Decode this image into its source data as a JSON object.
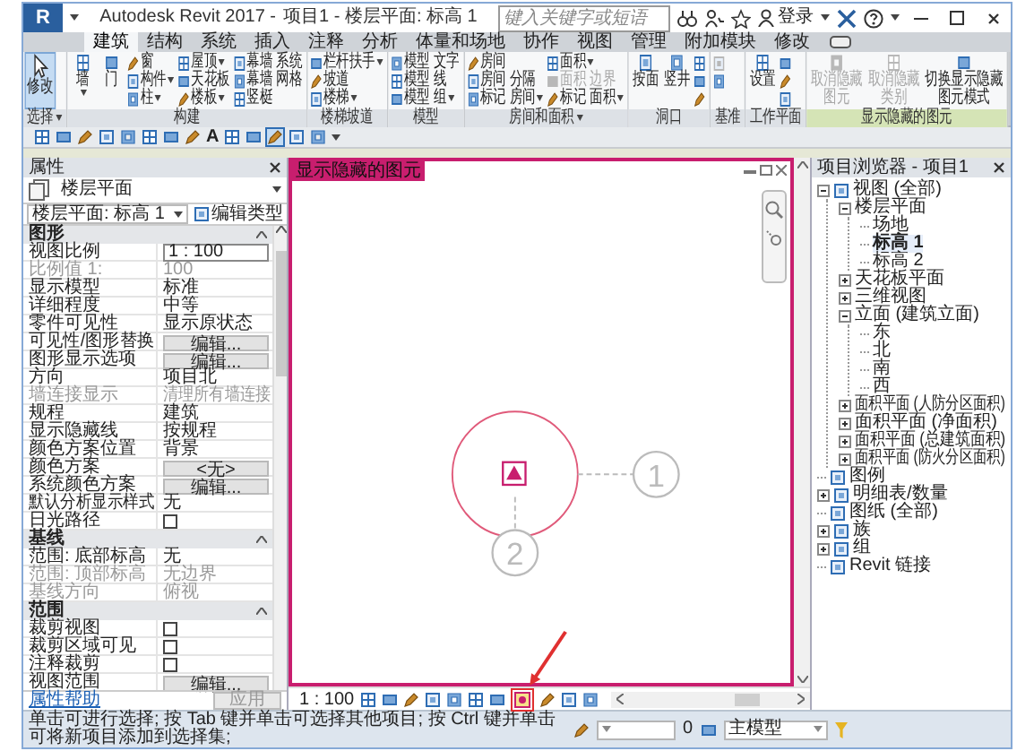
{
  "window": {
    "logo": "R",
    "title": "Autodesk Revit 2017 -",
    "document": "项目1 - 楼层平面: 标高 1"
  },
  "search": {
    "placeholder": "键入关键字或短语"
  },
  "account": {
    "label": "登录"
  },
  "tabs": [
    {
      "label": "建筑",
      "selected": true
    },
    {
      "label": "结构",
      "selected": false
    },
    {
      "label": "系统",
      "selected": false
    },
    {
      "label": "插入",
      "selected": false
    },
    {
      "label": "注释",
      "selected": false
    },
    {
      "label": "分析",
      "selected": false
    },
    {
      "label": "体量和场地",
      "selected": false
    },
    {
      "label": "协作",
      "selected": false
    },
    {
      "label": "视图",
      "selected": false
    },
    {
      "label": "管理",
      "selected": false
    },
    {
      "label": "附加模块",
      "selected": false
    },
    {
      "label": "修改",
      "selected": false
    }
  ],
  "ribbon": {
    "panels": [
      {
        "label": "选择",
        "menu": true,
        "highlighted": false,
        "buttons": [
          {
            "kind": "large",
            "label": "修改",
            "dropdown": false,
            "disabled": false,
            "pressed": true
          }
        ]
      },
      {
        "label": "构建",
        "menu": false,
        "highlighted": false,
        "buttons": [
          {
            "kind": "large",
            "label": "墙",
            "dropdown": true,
            "disabled": false,
            "pressed": false
          },
          {
            "kind": "large",
            "label": "门",
            "dropdown": false,
            "disabled": false,
            "pressed": false
          },
          {
            "kind": "small",
            "label": "窗",
            "dropdown": false,
            "disabled": false,
            "pressed": false
          },
          {
            "kind": "small",
            "label": "构件",
            "dropdown": true,
            "disabled": false,
            "pressed": false
          },
          {
            "kind": "small",
            "label": "柱",
            "dropdown": true,
            "disabled": false,
            "pressed": false
          },
          {
            "kind": "small",
            "label": "屋顶",
            "dropdown": true,
            "disabled": false,
            "pressed": false
          },
          {
            "kind": "small",
            "label": "天花板",
            "dropdown": false,
            "disabled": false,
            "pressed": false
          },
          {
            "kind": "small",
            "label": "楼板",
            "dropdown": true,
            "disabled": false,
            "pressed": false
          },
          {
            "kind": "small",
            "label": "幕墙 系统",
            "dropdown": false,
            "disabled": false,
            "pressed": false
          },
          {
            "kind": "small",
            "label": "幕墙 网格",
            "dropdown": false,
            "disabled": false,
            "pressed": false
          },
          {
            "kind": "small",
            "label": "竖梃",
            "dropdown": false,
            "disabled": false,
            "pressed": false
          }
        ]
      },
      {
        "label": "楼梯坡道",
        "menu": false,
        "highlighted": false,
        "buttons": [
          {
            "kind": "small",
            "label": "栏杆扶手",
            "dropdown": true,
            "disabled": false,
            "pressed": false
          },
          {
            "kind": "small",
            "label": "坡道",
            "dropdown": false,
            "disabled": false,
            "pressed": false
          },
          {
            "kind": "small",
            "label": "楼梯",
            "dropdown": true,
            "disabled": false,
            "pressed": false
          }
        ]
      },
      {
        "label": "模型",
        "menu": false,
        "highlighted": false,
        "buttons": [
          {
            "kind": "small",
            "label": "模型 文字",
            "dropdown": false,
            "disabled": false,
            "pressed": false
          },
          {
            "kind": "small",
            "label": "模型 线",
            "dropdown": false,
            "disabled": false,
            "pressed": false
          },
          {
            "kind": "small",
            "label": "模型 组",
            "dropdown": true,
            "disabled": false,
            "pressed": false
          }
        ]
      },
      {
        "label": "房间和面积",
        "menu": true,
        "highlighted": false,
        "buttons": [
          {
            "kind": "small",
            "label": "房间",
            "dropdown": false,
            "disabled": false,
            "pressed": false
          },
          {
            "kind": "small",
            "label": "房间 分隔",
            "dropdown": false,
            "disabled": false,
            "pressed": false
          },
          {
            "kind": "small",
            "label": "标记 房间",
            "dropdown": true,
            "disabled": false,
            "pressed": false
          },
          {
            "kind": "small",
            "label": "面积",
            "dropdown": true,
            "disabled": false,
            "pressed": false
          },
          {
            "kind": "small",
            "label": "面积 边界",
            "dropdown": false,
            "disabled": true,
            "pressed": false
          },
          {
            "kind": "small",
            "label": "标记 面积",
            "dropdown": true,
            "disabled": false,
            "pressed": false
          }
        ]
      },
      {
        "label": "洞口",
        "menu": false,
        "highlighted": false,
        "buttons": [
          {
            "kind": "large",
            "label": "按面",
            "dropdown": false,
            "disabled": false,
            "pressed": false
          },
          {
            "kind": "large",
            "label": "竖井",
            "dropdown": false,
            "disabled": false,
            "pressed": false
          },
          {
            "kind": "icon",
            "dropdown": false,
            "disabled": false,
            "pressed": false
          },
          {
            "kind": "icon",
            "dropdown": false,
            "disabled": false,
            "pressed": false
          },
          {
            "kind": "icon",
            "dropdown": false,
            "disabled": false,
            "pressed": false
          }
        ]
      },
      {
        "label": "基准",
        "menu": false,
        "highlighted": false,
        "buttons": [
          {
            "kind": "icon",
            "dropdown": false,
            "disabled": true,
            "pressed": false
          },
          {
            "kind": "icon",
            "dropdown": false,
            "disabled": false,
            "pressed": false
          }
        ]
      },
      {
        "label": "工作平面",
        "menu": false,
        "highlighted": false,
        "buttons": [
          {
            "kind": "large",
            "label": "设置",
            "dropdown": false,
            "disabled": false,
            "pressed": false
          },
          {
            "kind": "icon",
            "dropdown": false,
            "disabled": false,
            "pressed": false
          },
          {
            "kind": "icon",
            "dropdown": false,
            "disabled": false,
            "pressed": false
          },
          {
            "kind": "icon",
            "dropdown": false,
            "disabled": false,
            "pressed": false
          }
        ]
      },
      {
        "label": "显示隐藏的图元",
        "menu": false,
        "highlighted": true,
        "buttons": [
          {
            "kind": "large",
            "label": "取消隐藏图元",
            "dropdown": false,
            "disabled": true,
            "pressed": false
          },
          {
            "kind": "large",
            "label": "取消隐藏类别",
            "dropdown": false,
            "disabled": true,
            "pressed": false
          },
          {
            "kind": "large",
            "label": "切换显示隐藏图元模式",
            "dropdown": false,
            "disabled": false,
            "pressed": false
          }
        ]
      }
    ]
  },
  "quick_access": {
    "text_tool": "A"
  },
  "properties": {
    "title": "属性",
    "type_name": "楼层平面",
    "instance": "楼层平面: 标高 1",
    "edit_type": "编辑类型",
    "groups": [
      {
        "name": "图形",
        "rows": [
          {
            "label": "视图比例",
            "value": "1 : 100",
            "kind": "input",
            "disabled": false
          },
          {
            "label": "比例值 1:",
            "value": "100",
            "kind": "text",
            "disabled": true
          },
          {
            "label": "显示模型",
            "value": "标准",
            "kind": "text",
            "disabled": false
          },
          {
            "label": "详细程度",
            "value": "中等",
            "kind": "text",
            "disabled": false
          },
          {
            "label": "零件可见性",
            "value": "显示原状态",
            "kind": "text",
            "disabled": false
          },
          {
            "label": "可见性/图形替换",
            "value": "编辑...",
            "kind": "button",
            "disabled": false
          },
          {
            "label": "图形显示选项",
            "value": "编辑...",
            "kind": "button",
            "disabled": false
          },
          {
            "label": "方向",
            "value": "项目北",
            "kind": "text",
            "disabled": false
          },
          {
            "label": "墙连接显示",
            "value": "清理所有墙连接",
            "kind": "text",
            "disabled": true
          },
          {
            "label": "规程",
            "value": "建筑",
            "kind": "text",
            "disabled": false
          },
          {
            "label": "显示隐藏线",
            "value": "按规程",
            "kind": "text",
            "disabled": false
          },
          {
            "label": "颜色方案位置",
            "value": "背景",
            "kind": "text",
            "disabled": false
          },
          {
            "label": "颜色方案",
            "value": "<无>",
            "kind": "button",
            "disabled": false
          },
          {
            "label": "系统颜色方案",
            "value": "编辑...",
            "kind": "button",
            "disabled": false
          },
          {
            "label": "默认分析显示样式",
            "value": "无",
            "kind": "text",
            "disabled": false
          },
          {
            "label": "日光路径",
            "kind": "checkbox",
            "checked": false,
            "disabled": false
          }
        ]
      },
      {
        "name": "基线",
        "rows": [
          {
            "label": "范围: 底部标高",
            "value": "无",
            "kind": "text",
            "disabled": false
          },
          {
            "label": "范围: 顶部标高",
            "value": "无边界",
            "kind": "text",
            "disabled": true
          },
          {
            "label": "基线方向",
            "value": "俯视",
            "kind": "text",
            "disabled": true
          }
        ]
      },
      {
        "name": "范围",
        "rows": [
          {
            "label": "裁剪视图",
            "kind": "checkbox",
            "checked": false,
            "disabled": false
          },
          {
            "label": "裁剪区域可见",
            "kind": "checkbox",
            "checked": false,
            "disabled": false
          },
          {
            "label": "注释裁剪",
            "kind": "checkbox",
            "checked": false,
            "disabled": false
          },
          {
            "label": "视图范围",
            "value": "编辑...",
            "kind": "button",
            "disabled": false
          }
        ]
      }
    ],
    "help": "属性帮助",
    "apply": "应用"
  },
  "view": {
    "title": "显示隐藏的图元",
    "scale": "1 : 100",
    "bubbles": [
      "1",
      "2"
    ]
  },
  "project_browser": {
    "title": "项目浏览器 - 项目1",
    "tree": [
      {
        "label": "视图 (全部)",
        "expanded": true,
        "selected": false,
        "children": [
          {
            "label": "楼层平面",
            "expanded": true,
            "selected": false,
            "children": [
              {
                "label": "场地",
                "selected": false
              },
              {
                "label": "标高 1",
                "selected": true
              },
              {
                "label": "标高 2",
                "selected": false
              }
            ]
          },
          {
            "label": "天花板平面",
            "expanded": false,
            "selected": false
          },
          {
            "label": "三维视图",
            "expanded": false,
            "selected": false
          },
          {
            "label": "立面 (建筑立面)",
            "expanded": true,
            "selected": false,
            "children": [
              {
                "label": "东",
                "selected": false
              },
              {
                "label": "北",
                "selected": false
              },
              {
                "label": "南",
                "selected": false
              },
              {
                "label": "西",
                "selected": false
              }
            ]
          },
          {
            "label": "面积平面 (人防分区面积)",
            "expanded": false,
            "selected": false
          },
          {
            "label": "面积平面 (净面积)",
            "expanded": false,
            "selected": false
          },
          {
            "label": "面积平面 (总建筑面积)",
            "expanded": false,
            "selected": false
          },
          {
            "label": "面积平面 (防火分区面积)",
            "expanded": false,
            "selected": false
          }
        ]
      },
      {
        "label": "图例",
        "selected": false
      },
      {
        "label": "明细表/数量",
        "expanded": false,
        "selected": false
      },
      {
        "label": "图纸 (全部)",
        "selected": false
      },
      {
        "label": "族",
        "expanded": false,
        "selected": false
      },
      {
        "label": "组",
        "expanded": false,
        "selected": false
      },
      {
        "label": "Revit 链接",
        "selected": false
      }
    ]
  },
  "status_bar": {
    "message": "单击可进行选择; 按 Tab 键并单击可选择其他项目; 按 Ctrl 键并单击可将新项目添加到选择集;",
    "selection_count": "0",
    "model": "主模型"
  }
}
